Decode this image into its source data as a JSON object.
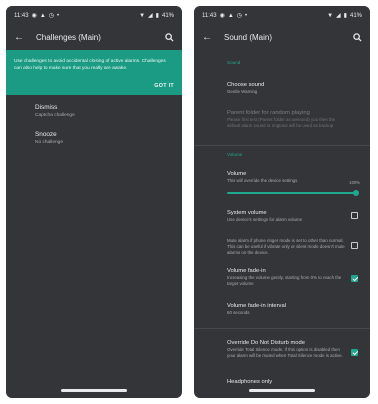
{
  "left": {
    "status": {
      "time": "11:43",
      "battery": "41%"
    },
    "appbar": {
      "title": "Challenges (Main)"
    },
    "banner": {
      "text": "Use challenges to avoid accidental closing of active alarms. Challenges can also help to make sure that you really are awake.",
      "action": "GOT IT"
    },
    "items": [
      {
        "title": "Dismiss",
        "subtitle": "Captcha challenge"
      },
      {
        "title": "Snooze",
        "subtitle": "No challenge"
      }
    ]
  },
  "right": {
    "status": {
      "time": "11:43",
      "battery": "41%"
    },
    "appbar": {
      "title": "Sound (Main)"
    },
    "sections": {
      "sound": "Sound",
      "volume": "Volume"
    },
    "choose_sound": {
      "title": "Choose sound",
      "subtitle": "Gentle Warning"
    },
    "parent_folder": {
      "title": "Parent folder for random playing",
      "subtitle": "Please first test (Parent folder as selected) you then the default alarm sound or ringtone will be used as backup"
    },
    "volume": {
      "title": "Volume",
      "subtitle": "This will override the device settings",
      "value_label": "100%",
      "level": 1.0
    },
    "system_volume": {
      "title": "System volume",
      "subtitle": "Use device's settings for alarm volume",
      "checked": false
    },
    "mute_alarm": {
      "subtitle": "Mute alarm if phone ringer mode is set to other than normal. This can be useful if vibrate only or silent mode doesn't mute alarms on the device.",
      "checked": false
    },
    "volume_fade": {
      "title": "Volume fade-in",
      "subtitle": "Increasing the volume gently, starting from 0% to reach the target volume",
      "checked": true
    },
    "fade_interval": {
      "title": "Volume fade-in interval",
      "subtitle": "60 seconds"
    },
    "dnd": {
      "title": "Override Do Not Disturb mode",
      "subtitle": "Override Total Silence mode. If this option is disabled then your alarm will be muted when Total Silence mode is active.",
      "checked": true
    },
    "headphones": {
      "title": "Headphones only"
    }
  },
  "colors": {
    "accent": "#1fa88e",
    "banner": "#1b9a84",
    "background": "#333538"
  },
  "icons": [
    "back-arrow-icon",
    "search-icon",
    "whatsapp-icon",
    "notification-icon",
    "alarm-icon",
    "wifi-icon",
    "signal-icon",
    "battery-icon"
  ]
}
